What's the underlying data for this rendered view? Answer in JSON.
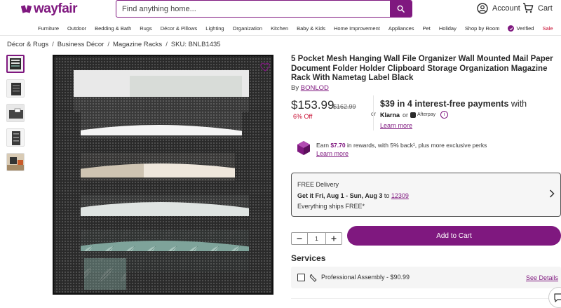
{
  "brand": {
    "name": "wayfair",
    "color": "#7f187f"
  },
  "search": {
    "placeholder": "Find anything home..."
  },
  "header": {
    "account_label": "Account",
    "cart_label": "Cart"
  },
  "nav": {
    "items": [
      "Furniture",
      "Outdoor",
      "Bedding & Bath",
      "Rugs",
      "Décor & Pillows",
      "Lighting",
      "Organization",
      "Kitchen",
      "Baby & Kids",
      "Home Improvement",
      "Appliances",
      "Pet",
      "Holiday",
      "Shop by Room"
    ],
    "verified_label": "Verified",
    "sale_label": "Sale"
  },
  "breadcrumb": {
    "items": [
      "Décor & Rugs",
      "Business Décor",
      "Magazine Racks"
    ],
    "sku": "SKU: BNLB1435"
  },
  "product": {
    "title": "5 Pocket Mesh Hanging Wall File Organizer Wall Mounted Mail Paper Document Folder Holder Clipboard Storage Organization Magazine Rack With Nametag Label Black",
    "by_prefix": "By",
    "brand": "BONLOD",
    "price": "$153.99",
    "old_price": "$162.99",
    "discount": "6% Off",
    "or_text": "or",
    "installment_amount": "$39",
    "installment_text": " in 4 interest-free payments",
    "installment_with": " with",
    "klarna_label": "Klarna",
    "or_small": "or",
    "afterpay_label": "Afterpay",
    "learn_more_1": "Learn more",
    "rewards_prefix": "Earn ",
    "rewards_amount": "$7.70",
    "rewards_suffix": " in rewards, with 5% back¹, plus more exclusive perks",
    "learn_more_2": "Learn more"
  },
  "delivery": {
    "line1": "FREE Delivery",
    "line2_dates": "Get it Fri, Aug 1 - Sun, Aug 3",
    "line2_to": " to ",
    "zip": "12309",
    "line3": "Everything ships FREE*"
  },
  "cart": {
    "quantity": "1",
    "add_to_cart": "Add to Cart"
  },
  "services": {
    "title": "Services",
    "assembly_label": "Professional Assembly - $90.99",
    "see_details": "See Details"
  },
  "colors": {
    "accent": "#7f187f",
    "sale": "#c7092d"
  }
}
